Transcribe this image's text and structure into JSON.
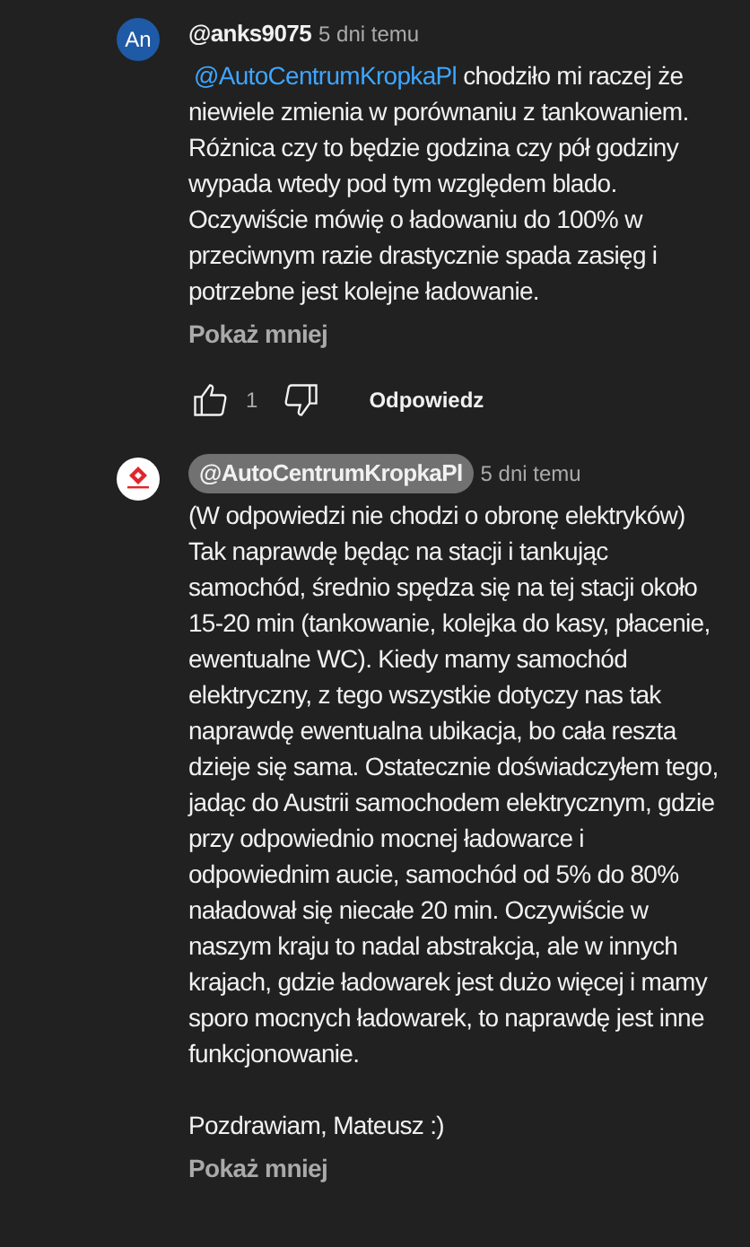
{
  "comments": [
    {
      "avatar": {
        "kind": "initials",
        "text": "An",
        "color": "#1f5aa6"
      },
      "author": "@anks9075",
      "author_highlighted": false,
      "time": "5 dni temu",
      "mention": "@AutoCentrumKropkaPl",
      "paragraphs": [
        "chodziło mi raczej że niewiele zmienia w porównaniu z tankowaniem. Różnica czy to będzie godzina czy pół godziny wypada wtedy pod tym względem blado. Oczywiście mówię o ładowaniu do 100% w przeciwnym razie drastycznie spada zasięg i potrzebne jest kolejne ładowanie."
      ],
      "toggle": "Pokaż mniej",
      "actions": {
        "likes": "1",
        "reply": "Odpowiedz"
      }
    },
    {
      "avatar": {
        "kind": "logo"
      },
      "author": "@AutoCentrumKropkaPl",
      "author_highlighted": true,
      "time": "5 dni temu",
      "paragraphs": [
        "(W odpowiedzi nie chodzi o obronę elektryków) Tak naprawdę będąc na stacji i tankując samochód, średnio spędza się na tej stacji około 15-20 min (tankowanie, kolejka do kasy, płacenie, ewentualne WC). Kiedy mamy samochód elektryczny, z tego wszystkie dotyczy nas tak naprawdę  ewentualna ubikacja, bo cała reszta dzieje się sama. Ostatecznie doświadczyłem tego, jadąc do Austrii samochodem elektrycznym, gdzie przy odpowiednio mocnej ładowarce i odpowiednim aucie, samochód od 5% do 80% naładował się niecałe 20 min. Oczywiście w naszym kraju to nadal abstrakcja, ale w innych krajach, gdzie ładowarek jest dużo więcej i mamy sporo mocnych ładowarek, to naprawdę jest inne funkcjonowanie.",
        "Pozdrawiam, Mateusz :)"
      ],
      "toggle": "Pokaż mniej"
    }
  ]
}
